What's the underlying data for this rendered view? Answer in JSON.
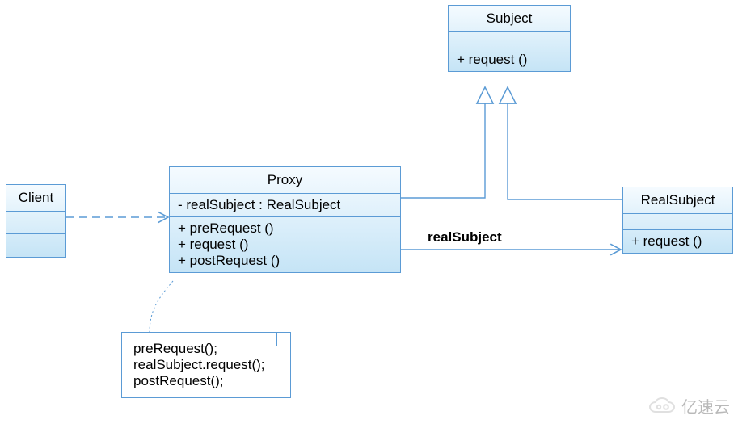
{
  "classes": {
    "subject": {
      "name": "Subject",
      "ops": [
        "+ request ()"
      ]
    },
    "client": {
      "name": "Client"
    },
    "proxy": {
      "name": "Proxy",
      "attrs": [
        "- realSubject : RealSubject"
      ],
      "ops": [
        "+ preRequest ()",
        "+ request ()",
        "+ postRequest ()"
      ]
    },
    "realSubject": {
      "name": "RealSubject",
      "ops": [
        "+ request ()"
      ]
    }
  },
  "assoc": {
    "proxy_to_real_label": "realSubject"
  },
  "note": {
    "lines": [
      "preRequest();",
      "realSubject.request();",
      "postRequest();"
    ]
  },
  "watermark": "亿速云"
}
